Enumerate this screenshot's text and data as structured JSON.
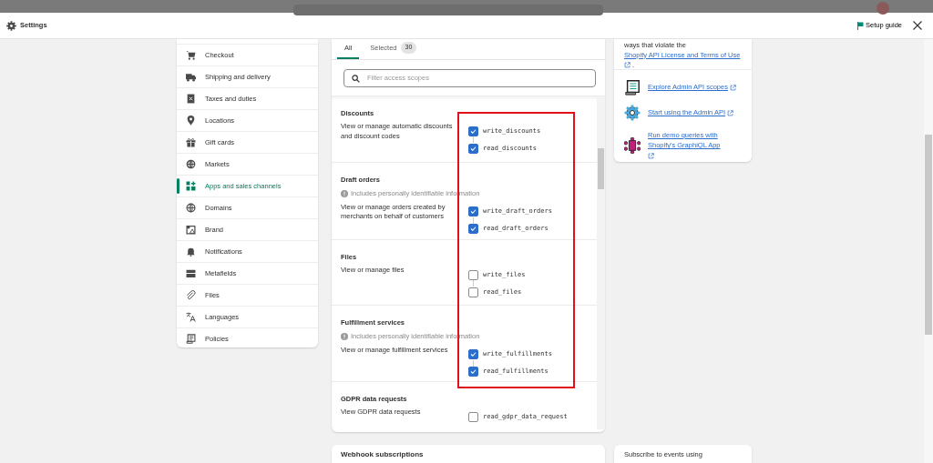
{
  "window": {
    "title": "Settings",
    "setup_guide": "Setup guide"
  },
  "sidebar": {
    "items": [
      {
        "label": "Checkout",
        "selected": false
      },
      {
        "label": "Shipping and delivery",
        "selected": false
      },
      {
        "label": "Taxes and duties",
        "selected": false
      },
      {
        "label": "Locations",
        "selected": false
      },
      {
        "label": "Gift cards",
        "selected": false
      },
      {
        "label": "Markets",
        "selected": false
      },
      {
        "label": "Apps and sales channels",
        "selected": true
      },
      {
        "label": "Domains",
        "selected": false
      },
      {
        "label": "Brand",
        "selected": false
      },
      {
        "label": "Notifications",
        "selected": false
      },
      {
        "label": "Metafields",
        "selected": false
      },
      {
        "label": "Files",
        "selected": false
      },
      {
        "label": "Languages",
        "selected": false
      },
      {
        "label": "Policies",
        "selected": false
      }
    ]
  },
  "scopes_card": {
    "tabs": [
      {
        "label": "All",
        "selected": true
      },
      {
        "label": "Selected",
        "count": "30",
        "selected": false
      }
    ],
    "search": {
      "placeholder": "Filter access scopes"
    },
    "sections": [
      {
        "title": "Discounts",
        "description": "View or manage automatic discounts and discount codes",
        "scopes": [
          {
            "name": "write_discounts",
            "checked": true
          },
          {
            "name": "read_discounts",
            "checked": true
          }
        ]
      },
      {
        "title": "Draft orders",
        "note": "Includes personally identifiable information",
        "description": "View or manage orders created by merchants on behalf of customers",
        "scopes": [
          {
            "name": "write_draft_orders",
            "checked": true
          },
          {
            "name": "read_draft_orders",
            "checked": true
          }
        ]
      },
      {
        "title": "Files",
        "description": "View or manage files",
        "scopes": [
          {
            "name": "write_files",
            "checked": false
          },
          {
            "name": "read_files",
            "checked": false
          }
        ]
      },
      {
        "title": "Fulfillment services",
        "note": "Includes personally identifiable information",
        "description": "View or manage fulfillment services",
        "scopes": [
          {
            "name": "write_fulfillments",
            "checked": true
          },
          {
            "name": "read_fulfillments",
            "checked": true
          }
        ]
      },
      {
        "title": "GDPR data requests",
        "description": "View GDPR data requests",
        "scopes": [
          {
            "name": "read_gdpr_data_request",
            "checked": false
          }
        ]
      }
    ]
  },
  "webhook_card": {
    "title": "Webhook subscriptions"
  },
  "info_card": {
    "text_before": "ways that violate the ",
    "link": "Shopify API License and Terms of Use",
    "text_after": " .",
    "links": [
      "Explore Admin API scopes",
      "Start using the Admin API",
      "Run demo queries with Shopify's GraphiQL App"
    ]
  },
  "subscribe_card": {
    "text": "Subscribe to events using"
  }
}
